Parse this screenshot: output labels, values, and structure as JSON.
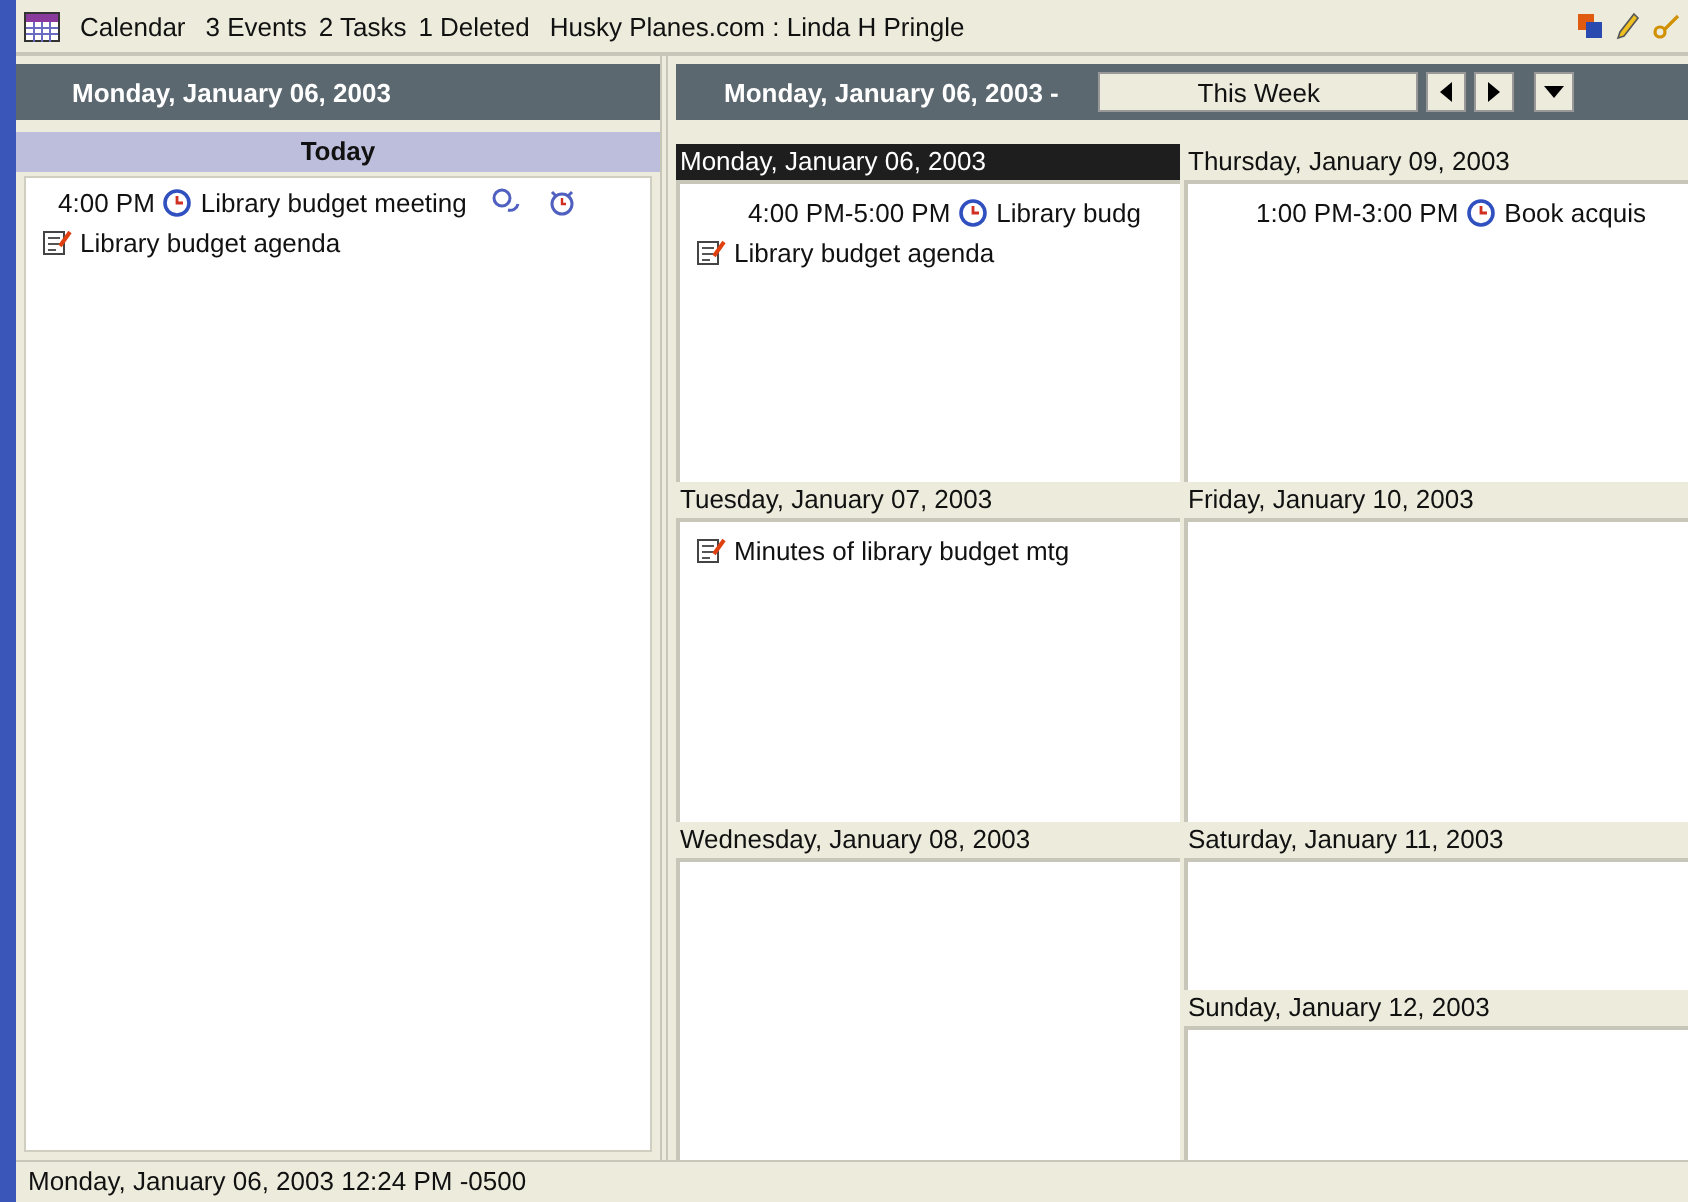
{
  "title_bar": {
    "app": "Calendar",
    "events": "3 Events",
    "tasks": "2 Tasks",
    "deleted": "1 Deleted",
    "account": "Husky Planes.com : Linda H Pringle"
  },
  "day_panel": {
    "header": "Monday, January 06, 2003",
    "band": "Today",
    "entries": [
      {
        "kind": "event",
        "time": "4:00 PM",
        "title": "Library budget meeting",
        "recurring": true,
        "alarm": true
      },
      {
        "kind": "task",
        "title": "Library budget agenda"
      }
    ]
  },
  "week_panel": {
    "header": "Monday, January 06, 2003 -",
    "range": "This Week",
    "columns": [
      {
        "days": [
          {
            "label": "Monday, January 06, 2003",
            "selected": true,
            "kind": "full",
            "entries": [
              {
                "kind": "event",
                "time": "4:00 PM-5:00 PM",
                "title": "Library budg"
              },
              {
                "kind": "task",
                "title": "Library budget agenda"
              }
            ]
          },
          {
            "label": "Tuesday, January 07, 2003",
            "selected": false,
            "kind": "full",
            "entries": [
              {
                "kind": "task",
                "title": "Minutes of library budget mtg"
              }
            ]
          },
          {
            "label": "Wednesday, January 08, 2003",
            "selected": false,
            "kind": "full"
          }
        ]
      },
      {
        "days": [
          {
            "label": "Thursday, January 09, 2003",
            "selected": false,
            "kind": "full",
            "entries": [
              {
                "kind": "event",
                "time": "1:00 PM-3:00 PM",
                "title": "Book acquis"
              }
            ]
          },
          {
            "label": "Friday, January 10, 2003",
            "selected": false,
            "kind": "full"
          },
          {
            "label": "Saturday, January 11, 2003",
            "selected": false,
            "kind": "half"
          },
          {
            "label": "Sunday, January 12, 2003",
            "selected": false,
            "kind": "half"
          }
        ]
      }
    ]
  },
  "status_bar": "Monday, January 06, 2003 12:24 PM -0500"
}
